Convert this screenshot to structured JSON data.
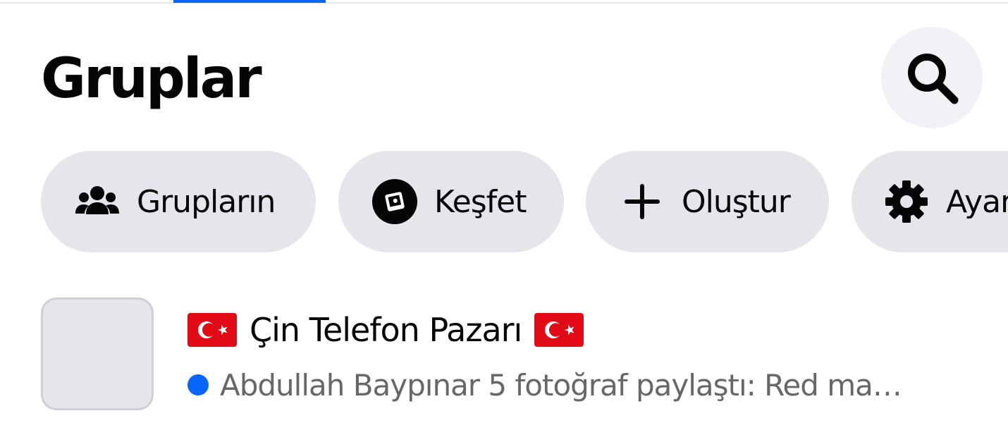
{
  "header": {
    "title": "Gruplar",
    "search_icon": "search-icon"
  },
  "chips": [
    {
      "label": "Grupların",
      "icon": "people-icon"
    },
    {
      "label": "Keşfet",
      "icon": "compass-icon"
    },
    {
      "label": "Oluştur",
      "icon": "plus-icon"
    },
    {
      "label": "Ayarlar",
      "icon": "gear-icon"
    }
  ],
  "groups": [
    {
      "name": "Çin Telefon Pazarı",
      "flag": "turkey-flag-icon",
      "activity": "Abdullah Baypınar 5 fotoğraf paylaştı: Red ma…",
      "unread": true
    }
  ],
  "colors": {
    "accent": "#0866ff",
    "chip_background": "#e4e6eb",
    "search_background": "#f0f2f5",
    "secondary_text": "#65676b",
    "flag_red": "#e30a17"
  }
}
